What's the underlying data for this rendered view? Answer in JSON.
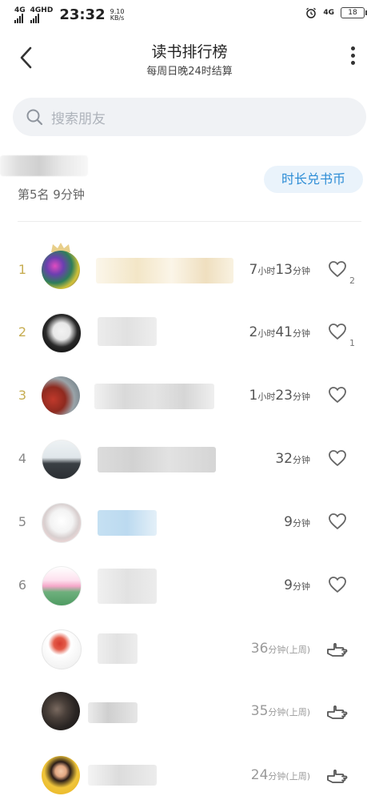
{
  "status_bar": {
    "net1": "4G",
    "net2": "4GHD",
    "time": "23:32",
    "speed_value": "9.10",
    "speed_unit": "KB/s",
    "net_right": "4G",
    "battery": "18"
  },
  "header": {
    "title": "读书排行榜",
    "subtitle": "每周日晚24时结算"
  },
  "search": {
    "placeholder": "搜索朋友"
  },
  "me": {
    "rank_text": "第5名 9分钟",
    "exchange_button": "时长兑书币"
  },
  "rows": [
    {
      "rank": "1",
      "dur_h": "7",
      "dur_h_unit": "小时",
      "dur_m": "13",
      "dur_m_unit": "分钟",
      "likes": "2"
    },
    {
      "rank": "2",
      "dur_h": "2",
      "dur_h_unit": "小时",
      "dur_m": "41",
      "dur_m_unit": "分钟",
      "likes": "1"
    },
    {
      "rank": "3",
      "dur_h": "1",
      "dur_h_unit": "小时",
      "dur_m": "23",
      "dur_m_unit": "分钟"
    },
    {
      "rank": "4",
      "dur_m": "32",
      "dur_m_unit": "分钟"
    },
    {
      "rank": "5",
      "dur_m": "9",
      "dur_m_unit": "分钟"
    },
    {
      "rank": "6",
      "dur_m": "9",
      "dur_m_unit": "分钟"
    },
    {
      "dur_m": "36",
      "dur_m_unit": "分钟(上周)"
    },
    {
      "dur_m": "35",
      "dur_m_unit": "分钟(上周)"
    },
    {
      "dur_m": "24",
      "dur_m_unit": "分钟(上周)"
    }
  ],
  "icons": {
    "back": "chevron-left-icon",
    "more": "more-vertical-icon",
    "search": "search-icon",
    "heart": "heart-outline-icon",
    "poke": "poke-hand-icon",
    "crown": "crown-icon"
  },
  "colors": {
    "accent_blue": "#2d8dd6",
    "rank_gold": "#c7ad52",
    "search_bg": "#f0f2f5"
  }
}
